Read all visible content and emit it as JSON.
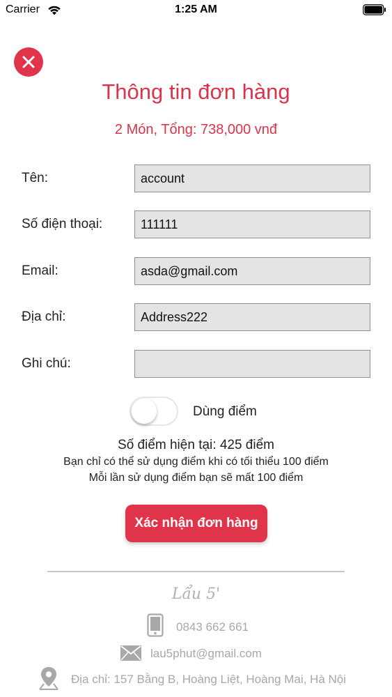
{
  "status_bar": {
    "carrier": "Carrier",
    "time": "1:25 AM",
    "icons": [
      "wifi-icon",
      "battery-icon"
    ]
  },
  "header": {
    "close_icon": "close-icon",
    "title": "Thông tin đơn hàng",
    "summary": "2 Món, Tổng: 738,000 vnđ"
  },
  "form": {
    "name": {
      "label": "Tên:",
      "value": "account"
    },
    "phone": {
      "label": "Số điện thoại:",
      "value": "111111"
    },
    "email": {
      "label": "Email:",
      "value": "asda@gmail.com"
    },
    "address": {
      "label": "Địa chỉ:",
      "value": "Address222"
    },
    "note": {
      "label": "Ghi chú:",
      "value": ""
    }
  },
  "points": {
    "toggle_label": "Dùng điểm",
    "toggle_on": false,
    "current": "Số điểm hiện tại: 425 điểm",
    "note_min": "Bạn chỉ có thể sử dụng điểm khi có tối thiểu 100 điểm",
    "note_cost": "Mỗi lần sử dụng điểm bạn sẽ mất 100 điểm"
  },
  "actions": {
    "confirm_label": "Xác nhận đơn hàng"
  },
  "footer": {
    "brand": "Lẩu 5'",
    "phone": "0843 662 661",
    "email": "lau5phut@gmail.com",
    "address": "Địa chỉ: 157 Bằng B, Hoàng Liệt, Hoàng Mai, Hà Nội",
    "icons": [
      "phone-icon",
      "mail-icon",
      "location-pin-icon"
    ]
  },
  "colors": {
    "accent": "#e0344a",
    "input_bg": "#e4e4e6",
    "footer_text": "#a8a8a8"
  }
}
